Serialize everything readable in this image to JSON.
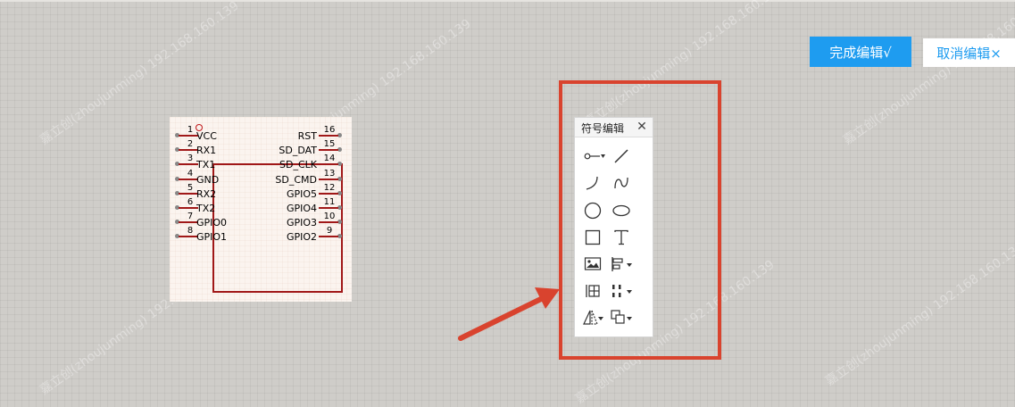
{
  "toolbar": {
    "done_label": "完成编辑√",
    "cancel_label": "取消编辑×"
  },
  "symbol": {
    "left_pins": [
      {
        "num": "1",
        "label": "VCC"
      },
      {
        "num": "2",
        "label": "RX1"
      },
      {
        "num": "3",
        "label": "TX1"
      },
      {
        "num": "4",
        "label": "GND"
      },
      {
        "num": "5",
        "label": "RX2"
      },
      {
        "num": "6",
        "label": "TX2"
      },
      {
        "num": "7",
        "label": "GPIO0"
      },
      {
        "num": "8",
        "label": "GPIO1"
      }
    ],
    "right_pins": [
      {
        "num": "16",
        "label": "RST"
      },
      {
        "num": "15",
        "label": "SD_DAT"
      },
      {
        "num": "14",
        "label": "SD_CLK"
      },
      {
        "num": "13",
        "label": "SD_CMD"
      },
      {
        "num": "12",
        "label": "GPIO5"
      },
      {
        "num": "11",
        "label": "GPIO4"
      },
      {
        "num": "10",
        "label": "GPIO3"
      },
      {
        "num": "9",
        "label": "GPIO2"
      }
    ]
  },
  "toolbox": {
    "title": "符号编辑",
    "close": "✕",
    "tools": [
      {
        "name": "pin-tool-icon"
      },
      {
        "name": "line-tool-icon"
      },
      {
        "name": "arc-tool-icon"
      },
      {
        "name": "bezier-tool-icon"
      },
      {
        "name": "circle-tool-icon"
      },
      {
        "name": "ellipse-tool-icon"
      },
      {
        "name": "rectangle-tool-icon"
      },
      {
        "name": "text-tool-icon"
      },
      {
        "name": "image-tool-icon"
      },
      {
        "name": "align-tool-icon"
      },
      {
        "name": "grid-tool-icon"
      },
      {
        "name": "distribute-tool-icon"
      },
      {
        "name": "flip-tool-icon"
      },
      {
        "name": "arrange-tool-icon"
      }
    ]
  },
  "watermark": {
    "text": "嘉立创(zhoujunming) 192.168.160.139"
  },
  "colors": {
    "accent": "#1e9cf0",
    "annotation": "#d9432e",
    "symbol_border": "#a01818",
    "canvas": "#cfcdc9"
  }
}
